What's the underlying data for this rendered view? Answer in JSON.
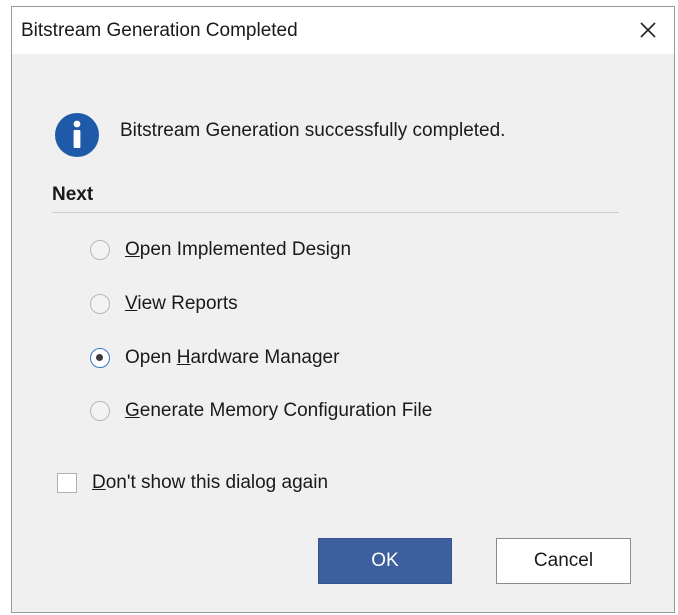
{
  "dialog": {
    "title": "Bitstream Generation Completed",
    "close_label": "✕",
    "icon": "info-icon",
    "message": "Bitstream Generation successfully completed.",
    "section_title": "Next"
  },
  "options": [
    {
      "mnemonic": "O",
      "rest": "pen Implemented Design",
      "selected": false
    },
    {
      "mnemonic": "V",
      "rest": "iew Reports",
      "selected": false
    },
    {
      "prefix": "Open ",
      "mnemonic": "H",
      "rest": "ardware Manager",
      "selected": true
    },
    {
      "mnemonic": "G",
      "rest": "enerate Memory Configuration File",
      "selected": false
    }
  ],
  "dont_show": {
    "mnemonic": "D",
    "rest": "on't show this dialog again",
    "checked": false
  },
  "buttons": {
    "ok": "OK",
    "cancel": "Cancel"
  },
  "colors": {
    "primary_button": "#3d5f9e",
    "info_icon": "#1f5aa8",
    "selected_radio": "#3c78c8"
  }
}
